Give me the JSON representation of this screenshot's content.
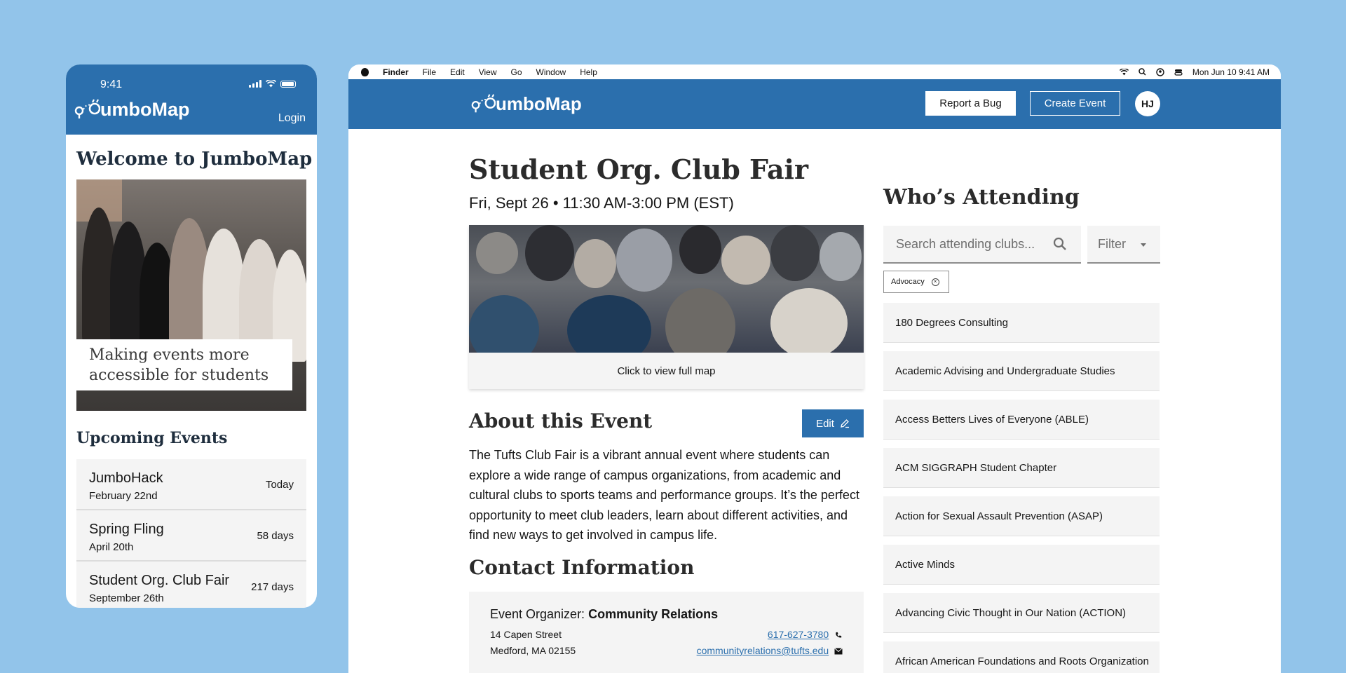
{
  "phone": {
    "time": "9:41",
    "logo_text": "umboMap",
    "login": "Login",
    "welcome": "Welcome to JumboMap",
    "hero_caption": "Making events more accessible for students",
    "upcoming_title": "Upcoming Events",
    "events": [
      {
        "name": "JumboHack",
        "date": "February 22nd",
        "days": "Today"
      },
      {
        "name": "Spring Fling",
        "date": "April 20th",
        "days": "58 days"
      },
      {
        "name": "Student Org. Club Fair",
        "date": "September 26th",
        "days": "217 days"
      }
    ]
  },
  "menubar": {
    "items": [
      "Finder",
      "File",
      "Edit",
      "View",
      "Go",
      "Window",
      "Help"
    ],
    "datetime": "Mon Jun 10  9:41 AM"
  },
  "header": {
    "logo_text": "umboMap",
    "report_bug": "Report a Bug",
    "create_event": "Create Event",
    "avatar": "HJ"
  },
  "event": {
    "title": "Student Org. Club Fair",
    "when": "Fri, Sept 26 • 11:30 AM-3:00 PM (EST)",
    "map_caption": "Click to view full map",
    "about_title": "About this Event",
    "edit": "Edit",
    "about_text": "The Tufts Club Fair is a vibrant annual event where students can explore a wide range of campus organizations, from academic and cultural clubs to sports teams and performance groups. It’s the perfect opportunity to meet club leaders, learn about different activities, and find new ways to get involved in campus life.",
    "contact_title": "Contact Information",
    "organizer_label": "Event Organizer:",
    "organizer_name": "Community Relations",
    "address_1": "14 Capen Street",
    "address_2": "Medford, MA 02155",
    "phone": "617-627-3780",
    "email": "communityrelations@tufts.edu"
  },
  "attending": {
    "title": "Who’s Attending",
    "search_placeholder": "Search attending clubs...",
    "filter_label": "Filter",
    "active_tag": "Advocacy",
    "clubs": [
      "180 Degrees Consulting",
      "Academic Advising and Undergraduate Studies",
      "Access Betters Lives of Everyone (ABLE)",
      "ACM SIGGRAPH Student Chapter",
      "Action for Sexual Assault Prevention (ASAP)",
      "Active Minds",
      "Advancing Civic Thought in Our Nation (ACTION)",
      "African American Foundations and Roots Organization"
    ]
  },
  "colors": {
    "brand_blue": "#2b6fad",
    "background": "#92c4ea"
  },
  "icons": [
    "logo-pin-icon",
    "search-icon",
    "pencil-icon",
    "phone-icon",
    "mail-icon",
    "close-circle-icon",
    "wifi-icon",
    "battery-icon",
    "signal-icon",
    "apple-icon"
  ]
}
